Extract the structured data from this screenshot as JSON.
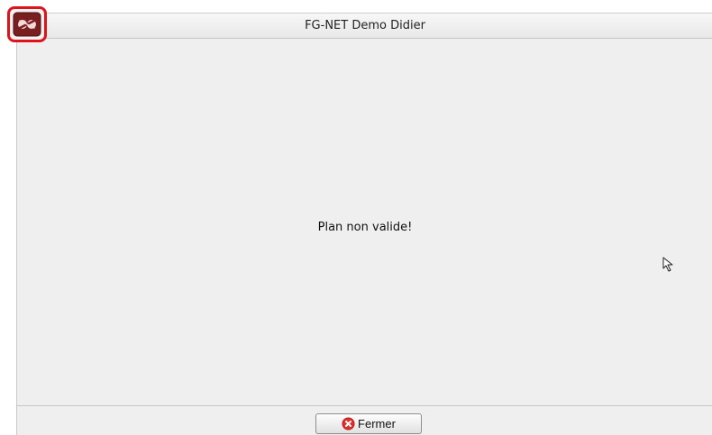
{
  "window": {
    "title": "FG-NET Demo Didier",
    "app_icon": "app-logo-icon"
  },
  "dialog": {
    "message": "Plan non valide!"
  },
  "footer": {
    "close_button": {
      "label": "Fermer",
      "icon": "close-icon"
    }
  },
  "colors": {
    "highlight": "#e0131a",
    "close_icon": "#e0302a",
    "app_icon": "#7a1f1f"
  }
}
